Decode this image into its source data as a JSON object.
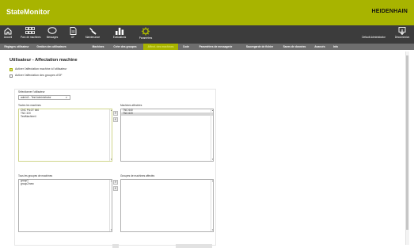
{
  "app": {
    "title": "StateMonitor",
    "brand": "HEIDENHAIN"
  },
  "nav": {
    "items": [
      {
        "label": "Accueil",
        "icon": "home-icon"
      },
      {
        "label": "Parc de machines",
        "icon": "grid-icon"
      },
      {
        "label": "Messages",
        "icon": "speech-bubble-icon"
      },
      {
        "label": "OF",
        "icon": "document-icon"
      },
      {
        "label": "Maintenance",
        "icon": "wrench-icon"
      },
      {
        "label": "Evaluations",
        "icon": "bar-chart-icon"
      },
      {
        "label": "Paramètres",
        "icon": "gear-icon"
      }
    ],
    "active_index": 6,
    "user_label": "Default Administrator",
    "logout_label": "Déconnexion",
    "logout_icon": "logout-icon"
  },
  "tabs": {
    "items": [
      "Réglages utilisateur",
      "Gestion des utilisateurs",
      "Machines",
      "Créer des groupes",
      "Affect. des machines",
      "Code",
      "Paramètres de messagerie",
      "Sauvegarde de fichier",
      "Saves de données",
      "Avancés",
      "Info"
    ],
    "active_index": 4
  },
  "page": {
    "title": "Utilisateur - Affectation machine",
    "checkbox_machines": {
      "label": "Activer l'affectation machine à l'utilisateur",
      "checked": true
    },
    "checkbox_groups": {
      "label": "Activer l'affectation des groupes d'OF",
      "checked": false
    },
    "select_user": {
      "label": "Sélectionner l'utilisateur",
      "value": "admin3 - Test Administrator",
      "caret": "∨"
    },
    "all_machines": {
      "label": "Toutes les machines",
      "items": [
        "CNC PILOT 640",
        "TNC 320",
        "TestMachine4"
      ]
    },
    "assigned_machines": {
      "label": "Machines affectées",
      "items": [
        "TNC 640",
        "TNC 620"
      ],
      "selected_index": 1
    },
    "all_groups": {
      "label": "Tous les groupes de machines",
      "items": [
        "group1",
        "group2/new"
      ]
    },
    "assigned_groups": {
      "label": "Groupes de machines affectés",
      "items": []
    },
    "arrow_right": "›",
    "arrow_left": "‹",
    "scroll_up": "▲",
    "scroll_down": "▼"
  },
  "colors": {
    "accent": "#a8b400",
    "nav_bg": "#3c3c3c",
    "tab_bg": "#6e6e6e"
  }
}
